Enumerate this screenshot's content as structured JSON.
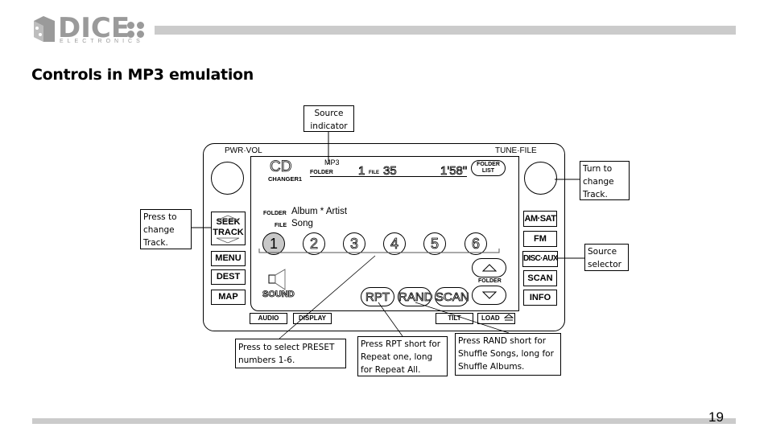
{
  "header": {
    "logo_word": "DICE",
    "logo_subtitle": "ELECTRONICS",
    "title": "Controls in MP3 emulation"
  },
  "footer": {
    "page_number": "19"
  },
  "radio": {
    "knob_left_label": "PWR·VOL",
    "knob_right_label": "TUNE·FILE",
    "left_buttons": {
      "seek": "SEEK",
      "track": "TRACK",
      "menu": "MENU",
      "dest": "DEST",
      "map": "MAP"
    },
    "right_buttons": [
      "AM·SAT",
      "FM",
      "DISC·AUX",
      "SCAN",
      "INFO"
    ],
    "bottom_buttons": {
      "audio": "AUDIO",
      "display": "DISPLAY",
      "tilt": "TILT",
      "load": "LOAD"
    },
    "screen": {
      "source": "CD",
      "changer": "CHANGER1",
      "mode": "MP3",
      "folder_label": "FOLDER",
      "folder_number": "1",
      "file_label": "FILE",
      "file_number": "35",
      "time": "1'58\"",
      "folder_list_button": [
        "FOLDER",
        "LIST"
      ],
      "info_folder_label": "FOLDER",
      "info_folder_value": "Album * Artist",
      "info_file_label": "FILE",
      "info_file_value": "Song",
      "presets": [
        "1",
        "2",
        "3",
        "4",
        "5",
        "6"
      ],
      "active_preset": "1",
      "sound_label": "SOUND",
      "pills": [
        "RPT",
        "RAND",
        "SCAN"
      ],
      "folder_nav_label": "FOLDER"
    }
  },
  "callouts": {
    "source_indicator": [
      "Source",
      "indicator"
    ],
    "press_change_track": [
      "Press to",
      "change",
      "Track."
    ],
    "turn_change_track": [
      "Turn to",
      "change",
      "Track."
    ],
    "source_selector": [
      "Source",
      "selector"
    ],
    "preset": [
      "Press to select PRESET",
      "numbers 1-6."
    ],
    "rpt": [
      "Press RPT short for",
      "Repeat one, long",
      "for Repeat All."
    ],
    "rand": [
      "Press RAND short for",
      "Shuffle Songs, long for",
      "Shuffle Albums."
    ]
  }
}
